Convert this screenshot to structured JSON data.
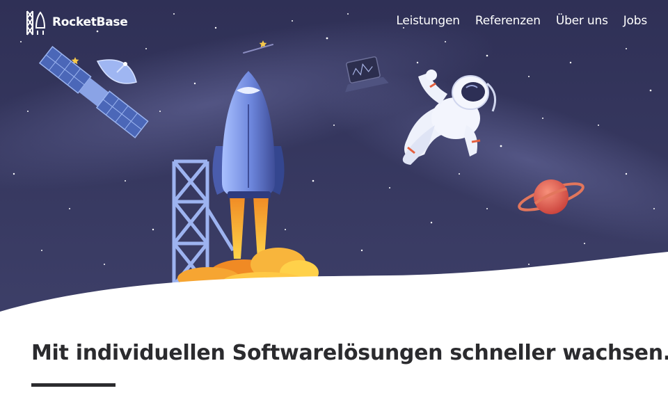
{
  "brand": {
    "name": "RocketBase"
  },
  "nav": {
    "items": [
      {
        "label": "Leistungen"
      },
      {
        "label": "Referenzen"
      },
      {
        "label": "Über uns"
      },
      {
        "label": "Jobs"
      }
    ]
  },
  "main": {
    "headline": "Mit individuellen Softwarelösungen schneller wachsen."
  },
  "colors": {
    "sky": "#393a62",
    "text_dark": "#2b2b2e",
    "flame": "#f5a623",
    "planet": "#e7604a",
    "rocket": "#6f86d6"
  },
  "icons": [
    "rocket-tower-logo-icon",
    "satellite-icon",
    "rocket-icon",
    "launch-tower-icon",
    "astronaut-icon",
    "laptop-icon",
    "planet-icon",
    "shooting-star-icon"
  ]
}
